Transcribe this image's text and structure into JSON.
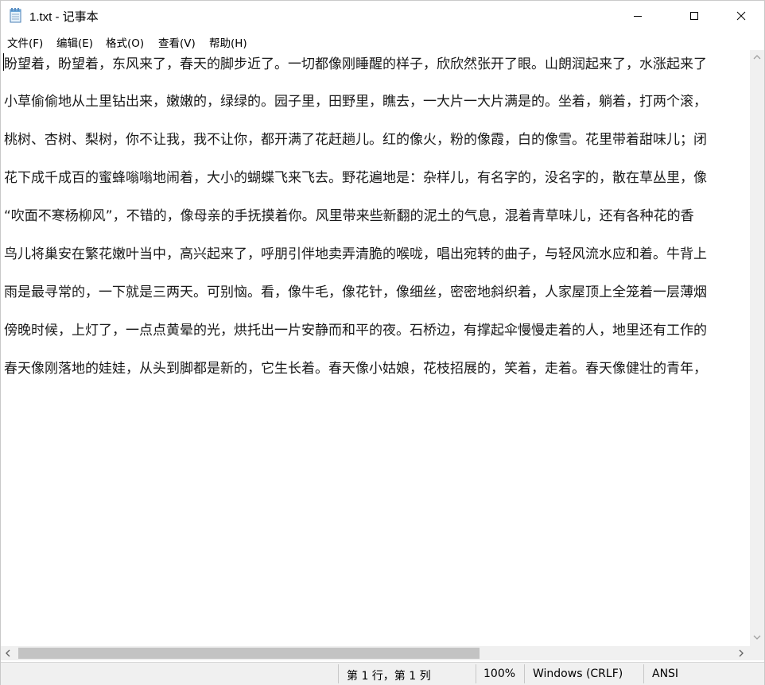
{
  "window": {
    "title": "1.txt - 记事本"
  },
  "menu": [
    {
      "label": "文件(F)"
    },
    {
      "label": "编辑(E)"
    },
    {
      "label": "格式(O)"
    },
    {
      "label": "查看(V)"
    },
    {
      "label": "帮助(H)"
    }
  ],
  "editor": {
    "lines": [
      "盼望着，盼望着，东风来了，春天的脚步近了。一切都像刚睡醒的样子，欣欣然张开了眼。山朗润起来了，水涨起来了",
      "小草偷偷地从土里钻出来，嫩嫩的，绿绿的。园子里，田野里，瞧去，一大片一大片满是的。坐着，躺着，打两个滚，",
      "桃树、杏树、梨树，你不让我，我不让你，都开满了花赶趟儿。红的像火，粉的像霞，白的像雪。花里带着甜味儿；闭",
      "花下成千成百的蜜蜂嗡嗡地闹着，大小的蝴蝶飞来飞去。野花遍地是：杂样儿，有名字的，没名字的，散在草丛里，像",
      "“吹面不寒杨柳风”，不错的，像母亲的手抚摸着你。风里带来些新翻的泥土的气息，混着青草味儿，还有各种花的香",
      "鸟儿将巢安在繁花嫩叶当中，高兴起来了，呼朋引伴地卖弄清脆的喉咙，唱出宛转的曲子，与轻风流水应和着。牛背上",
      "雨是最寻常的，一下就是三两天。可别恼。看，像牛毛，像花针，像细丝，密密地斜织着，人家屋顶上全笼着一层薄烟",
      "傍晚时候，上灯了，一点点黄晕的光，烘托出一片安静而和平的夜。石桥边，有撑起伞慢慢走着的人，地里还有工作的",
      "春天像刚落地的娃娃，从头到脚都是新的，它生长着。春天像小姑娘，花枝招展的，笑着，走着。春天像健壮的青年，"
    ]
  },
  "statusbar": {
    "position": "第 1 行，第 1 列",
    "zoom": "100%",
    "line_ending": "Windows (CRLF)",
    "encoding": "ANSI"
  }
}
